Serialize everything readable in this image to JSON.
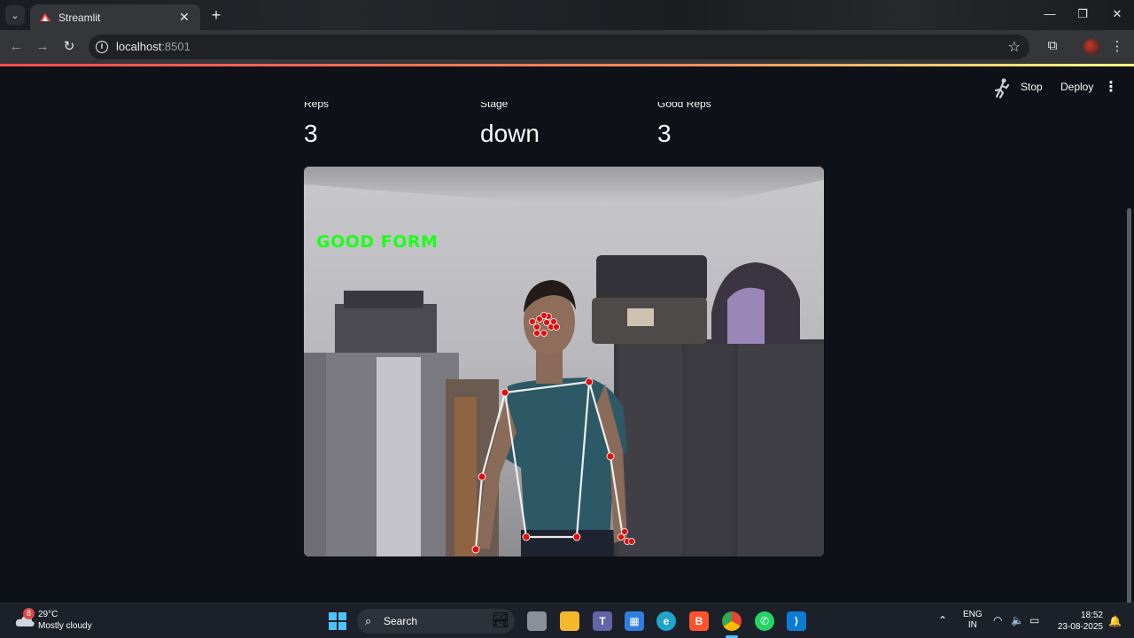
{
  "browser": {
    "tab_title": "Streamlit",
    "close_tab": "✕",
    "new_tab": "+",
    "url_host": "localhost",
    "url_port": ":8501"
  },
  "streamlit_header": {
    "stop_label": "Stop",
    "deploy_label": "Deploy"
  },
  "metrics": [
    {
      "label": "Reps",
      "value": "3"
    },
    {
      "label": "Stage",
      "value": "down"
    },
    {
      "label": "Good Reps",
      "value": "3"
    }
  ],
  "video": {
    "overlay_text": "GOOD FORM"
  },
  "taskbar": {
    "weather_badge": "8",
    "temperature": "29°C",
    "condition": "Mostly cloudy",
    "search_label": "Search",
    "lang_line1": "ENG",
    "lang_line2": "IN",
    "time": "18:52",
    "date": "23-08-2025"
  },
  "colors": {
    "app_bg": "#0e1117",
    "accent": "#ff4b4b",
    "overlay_green": "#1aff1a",
    "landmark_red": "#e01010"
  }
}
